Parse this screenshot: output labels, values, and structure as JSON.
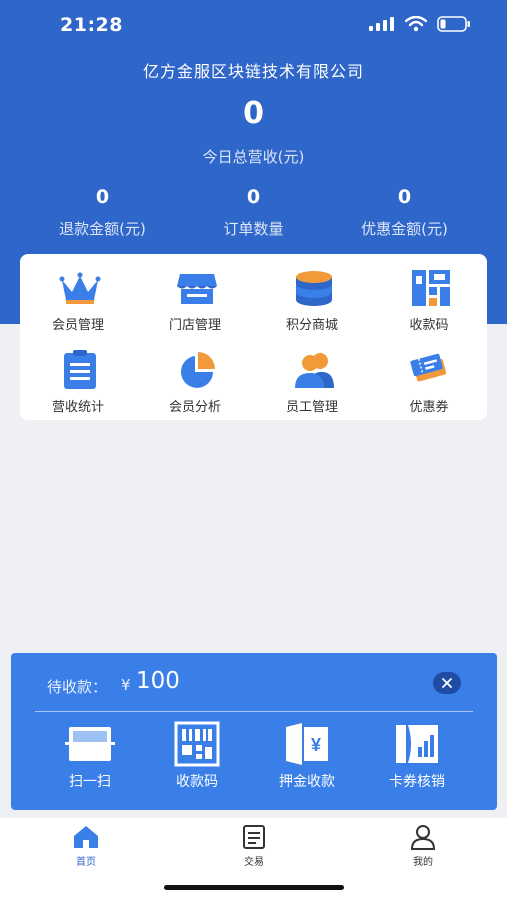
{
  "status_bar": {
    "time": "21:28"
  },
  "header": {
    "company": "亿方金服区块链技术有限公司",
    "total_value": "0",
    "total_label": "今日总营收(元)",
    "stats": [
      {
        "value": "0",
        "label": "退款金额(元)"
      },
      {
        "value": "0",
        "label": "订单数量"
      },
      {
        "value": "0",
        "label": "优惠金额(元)"
      }
    ]
  },
  "menu": [
    {
      "label": "会员管理",
      "icon": "crown-icon"
    },
    {
      "label": "门店管理",
      "icon": "store-icon"
    },
    {
      "label": "积分商城",
      "icon": "coins-stack-icon"
    },
    {
      "label": "收款码",
      "icon": "payment-code-icon"
    },
    {
      "label": "营收统计",
      "icon": "clipboard-list-icon"
    },
    {
      "label": "会员分析",
      "icon": "pie-chart-icon"
    },
    {
      "label": "员工管理",
      "icon": "staff-icon"
    },
    {
      "label": "优惠券",
      "icon": "coupon-icon"
    }
  ],
  "payment_panel": {
    "label": "待收款：",
    "currency": "¥",
    "amount": "100",
    "actions": [
      {
        "label": "扫一扫",
        "icon": "scan-icon"
      },
      {
        "label": "收款码",
        "icon": "qr-code-icon"
      },
      {
        "label": "押金收款",
        "icon": "deposit-icon"
      },
      {
        "label": "卡券核销",
        "icon": "card-redeem-icon"
      }
    ]
  },
  "tabbar": [
    {
      "label": "首页",
      "icon": "home-icon",
      "active": true
    },
    {
      "label": "交易",
      "icon": "transactions-icon",
      "active": false
    },
    {
      "label": "我的",
      "icon": "profile-icon",
      "active": false
    }
  ],
  "colors": {
    "header_blue": "#2f66c9",
    "panel_blue": "#3a7fe8",
    "accent_orange": "#f29a3a",
    "background": "#eff0f4"
  }
}
